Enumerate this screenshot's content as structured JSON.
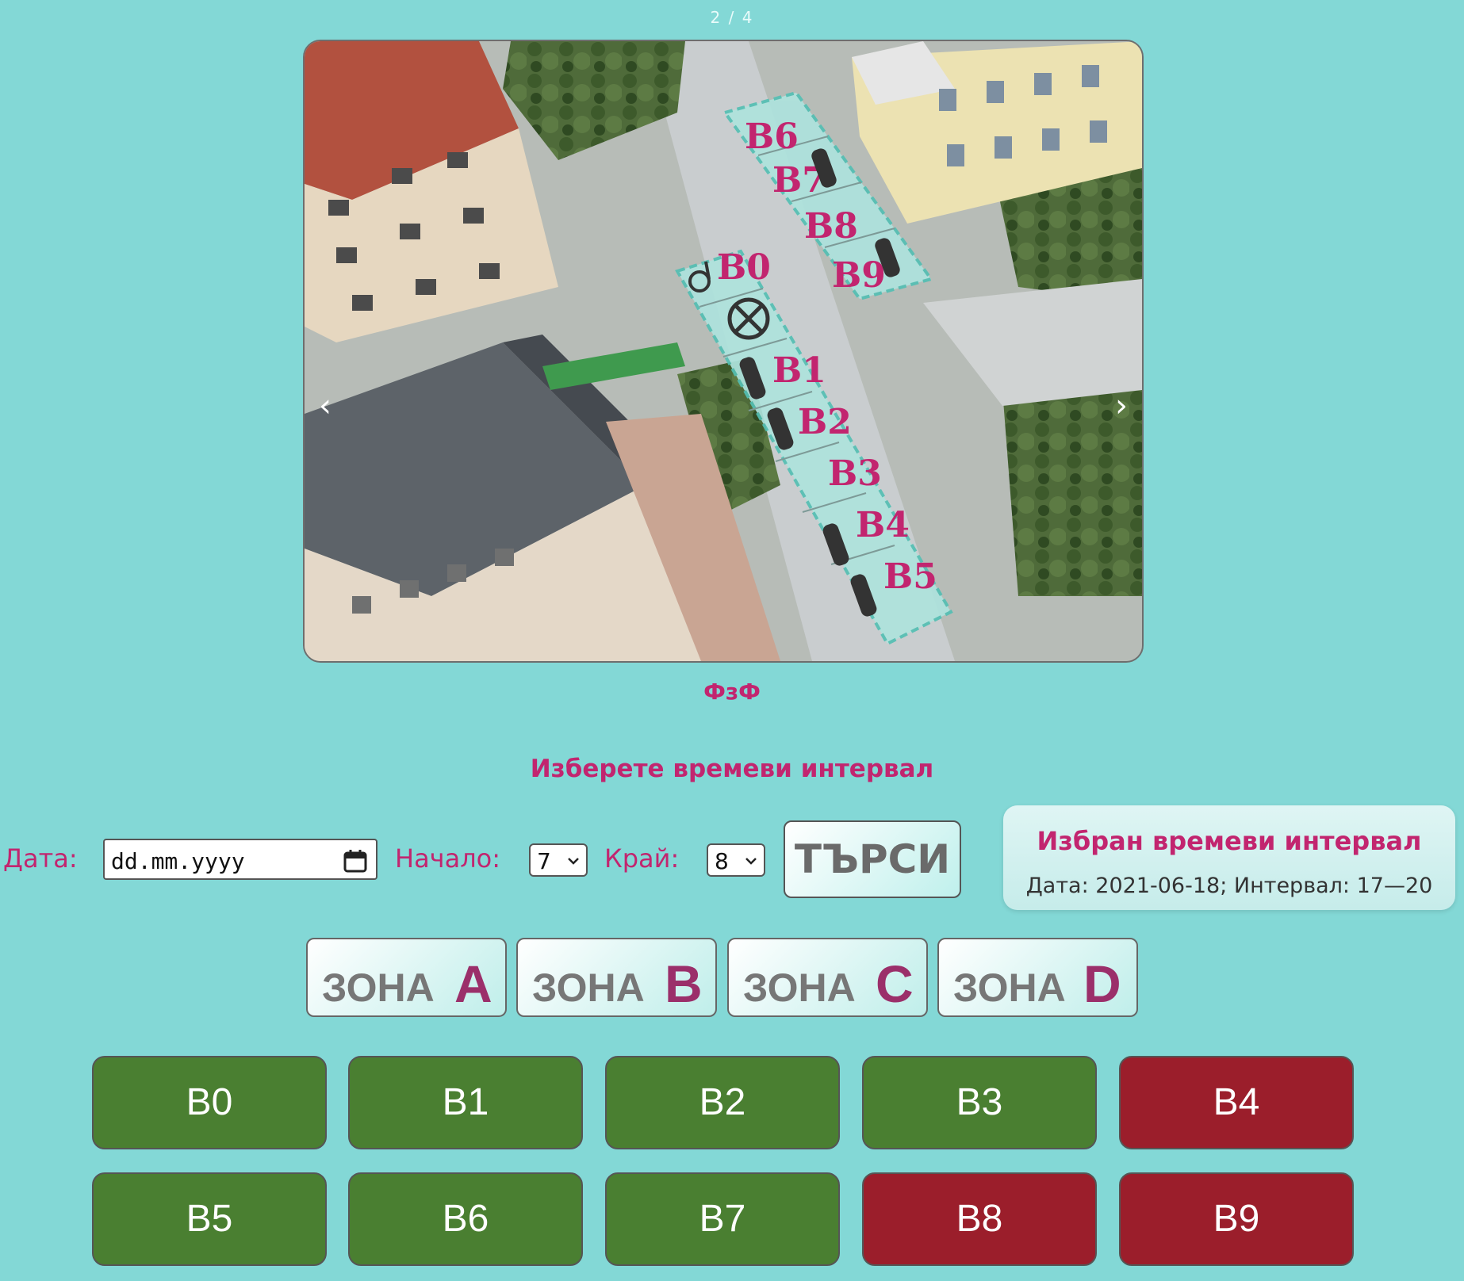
{
  "slider": {
    "counter": "2 / 4",
    "caption": "ФзФ",
    "prev_arrow": "‹",
    "next_arrow": "›",
    "map_labels": [
      "B6",
      "B7",
      "B8",
      "B9",
      "B0",
      "B1",
      "B2",
      "B3",
      "B4",
      "B5"
    ]
  },
  "form": {
    "heading": "Изберете времеви интервал",
    "date_label": "Дата:",
    "date_placeholder": "dd.mm.yyyy",
    "start_label": "Начало:",
    "start_value": "7",
    "end_label": "Край:",
    "end_value": "8",
    "search_label": "ТЪРСИ"
  },
  "selected": {
    "title": "Избран времеви интервал",
    "line": "Дата: 2021-06-18; Интервал: 17—20"
  },
  "zones": [
    {
      "word": "ЗОНА",
      "letter": "A"
    },
    {
      "word": "ЗОНА",
      "letter": "B"
    },
    {
      "word": "ЗОНА",
      "letter": "C"
    },
    {
      "word": "ЗОНА",
      "letter": "D"
    }
  ],
  "spots": [
    {
      "label": "B0",
      "status": "free"
    },
    {
      "label": "B1",
      "status": "free"
    },
    {
      "label": "B2",
      "status": "free"
    },
    {
      "label": "B3",
      "status": "free"
    },
    {
      "label": "B4",
      "status": "taken"
    },
    {
      "label": "B5",
      "status": "free"
    },
    {
      "label": "B6",
      "status": "free"
    },
    {
      "label": "B7",
      "status": "free"
    },
    {
      "label": "B8",
      "status": "taken"
    },
    {
      "label": "B9",
      "status": "taken"
    }
  ],
  "colors": {
    "background": "#83d8d6",
    "accent": "#c2256f",
    "free": "#4a7f31",
    "taken": "#9b1e2b"
  }
}
